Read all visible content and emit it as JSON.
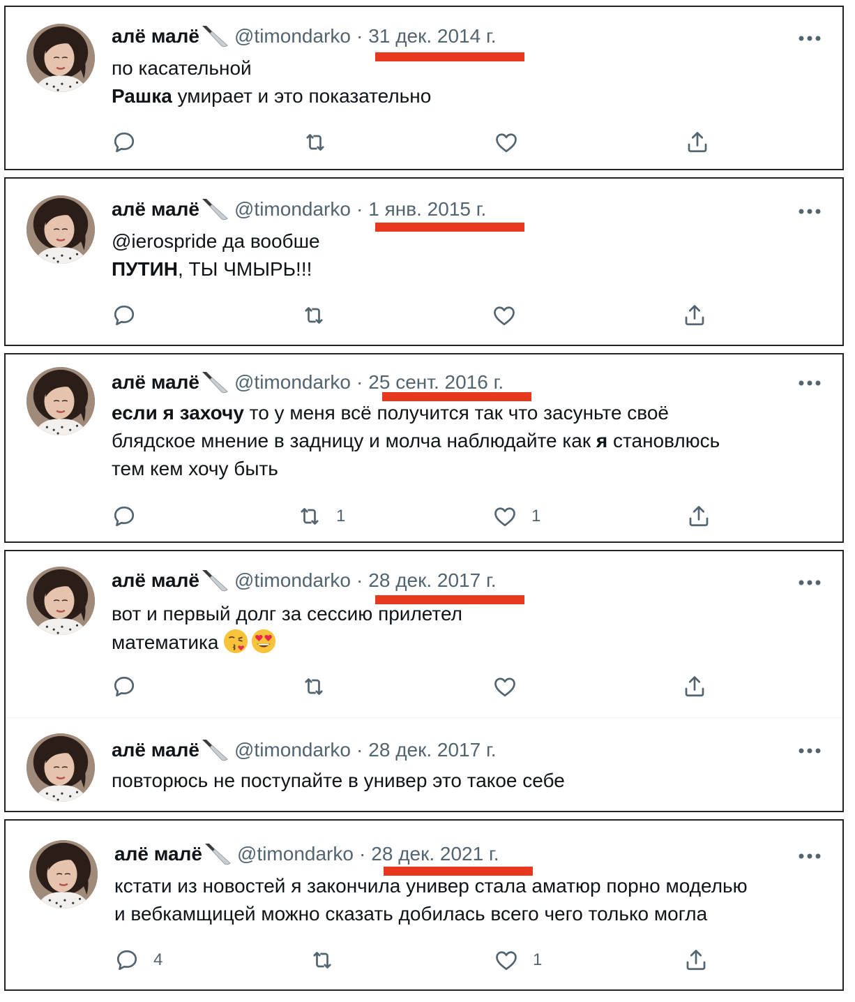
{
  "colors": {
    "underline": "#e8371f",
    "text": "#0f1419",
    "secondary": "#536471"
  },
  "tweets": [
    {
      "name": "алё малё",
      "handle": "@timondarko",
      "sep": "·",
      "date": "31 дек. 2014 г.",
      "line1": "по касательной",
      "line2_bold": "Рашка",
      "line2_rest": " умирает и это показательно"
    },
    {
      "name": "алё малё",
      "handle": "@timondarko",
      "sep": "·",
      "date": "1 янв. 2015 г.",
      "line1": "@ierospride да вообше",
      "line2_bold": "ПУТИН",
      "line2_rest": ", ТЫ ЧМЫРЬ!!!"
    },
    {
      "name": "алё малё",
      "handle": "@timondarko",
      "sep": "·",
      "date": "25 сент. 2016 г.",
      "line1_bold": "если я захочу",
      "line1_rest": " то у меня всё получится так что засуньте своё",
      "line2_start": "блядское мнение в задницу и молча наблюдайте как ",
      "line2_bold": "я",
      "line2_rest": " становлюсь",
      "line3": "тем кем хочу быть",
      "retweets": "1",
      "likes": "1"
    },
    {
      "name": "алё малё",
      "handle": "@timondarko",
      "sep": "·",
      "date": "28 дек. 2017 г.",
      "line1": "вот и первый долг за сессию прилетел",
      "line2": "математика",
      "emojis": [
        "kissing-face-icon",
        "heart-eyes-face-icon"
      ]
    },
    {
      "name": "алё малё",
      "handle": "@timondarko",
      "sep": "·",
      "date": "28 дек. 2017 г.",
      "line1": "повторюсь не поступайте в универ это такое себе"
    },
    {
      "name": "алё малё",
      "handle": "@timondarko",
      "sep": "·",
      "date": "28 дек. 2021 г.",
      "line1": "кстати из новостей я закончила универ стала аматюр порно моделью",
      "line2": "и вебкамщицей можно сказать добилась всего чего только могла",
      "replies": "4",
      "likes": "1"
    }
  ]
}
